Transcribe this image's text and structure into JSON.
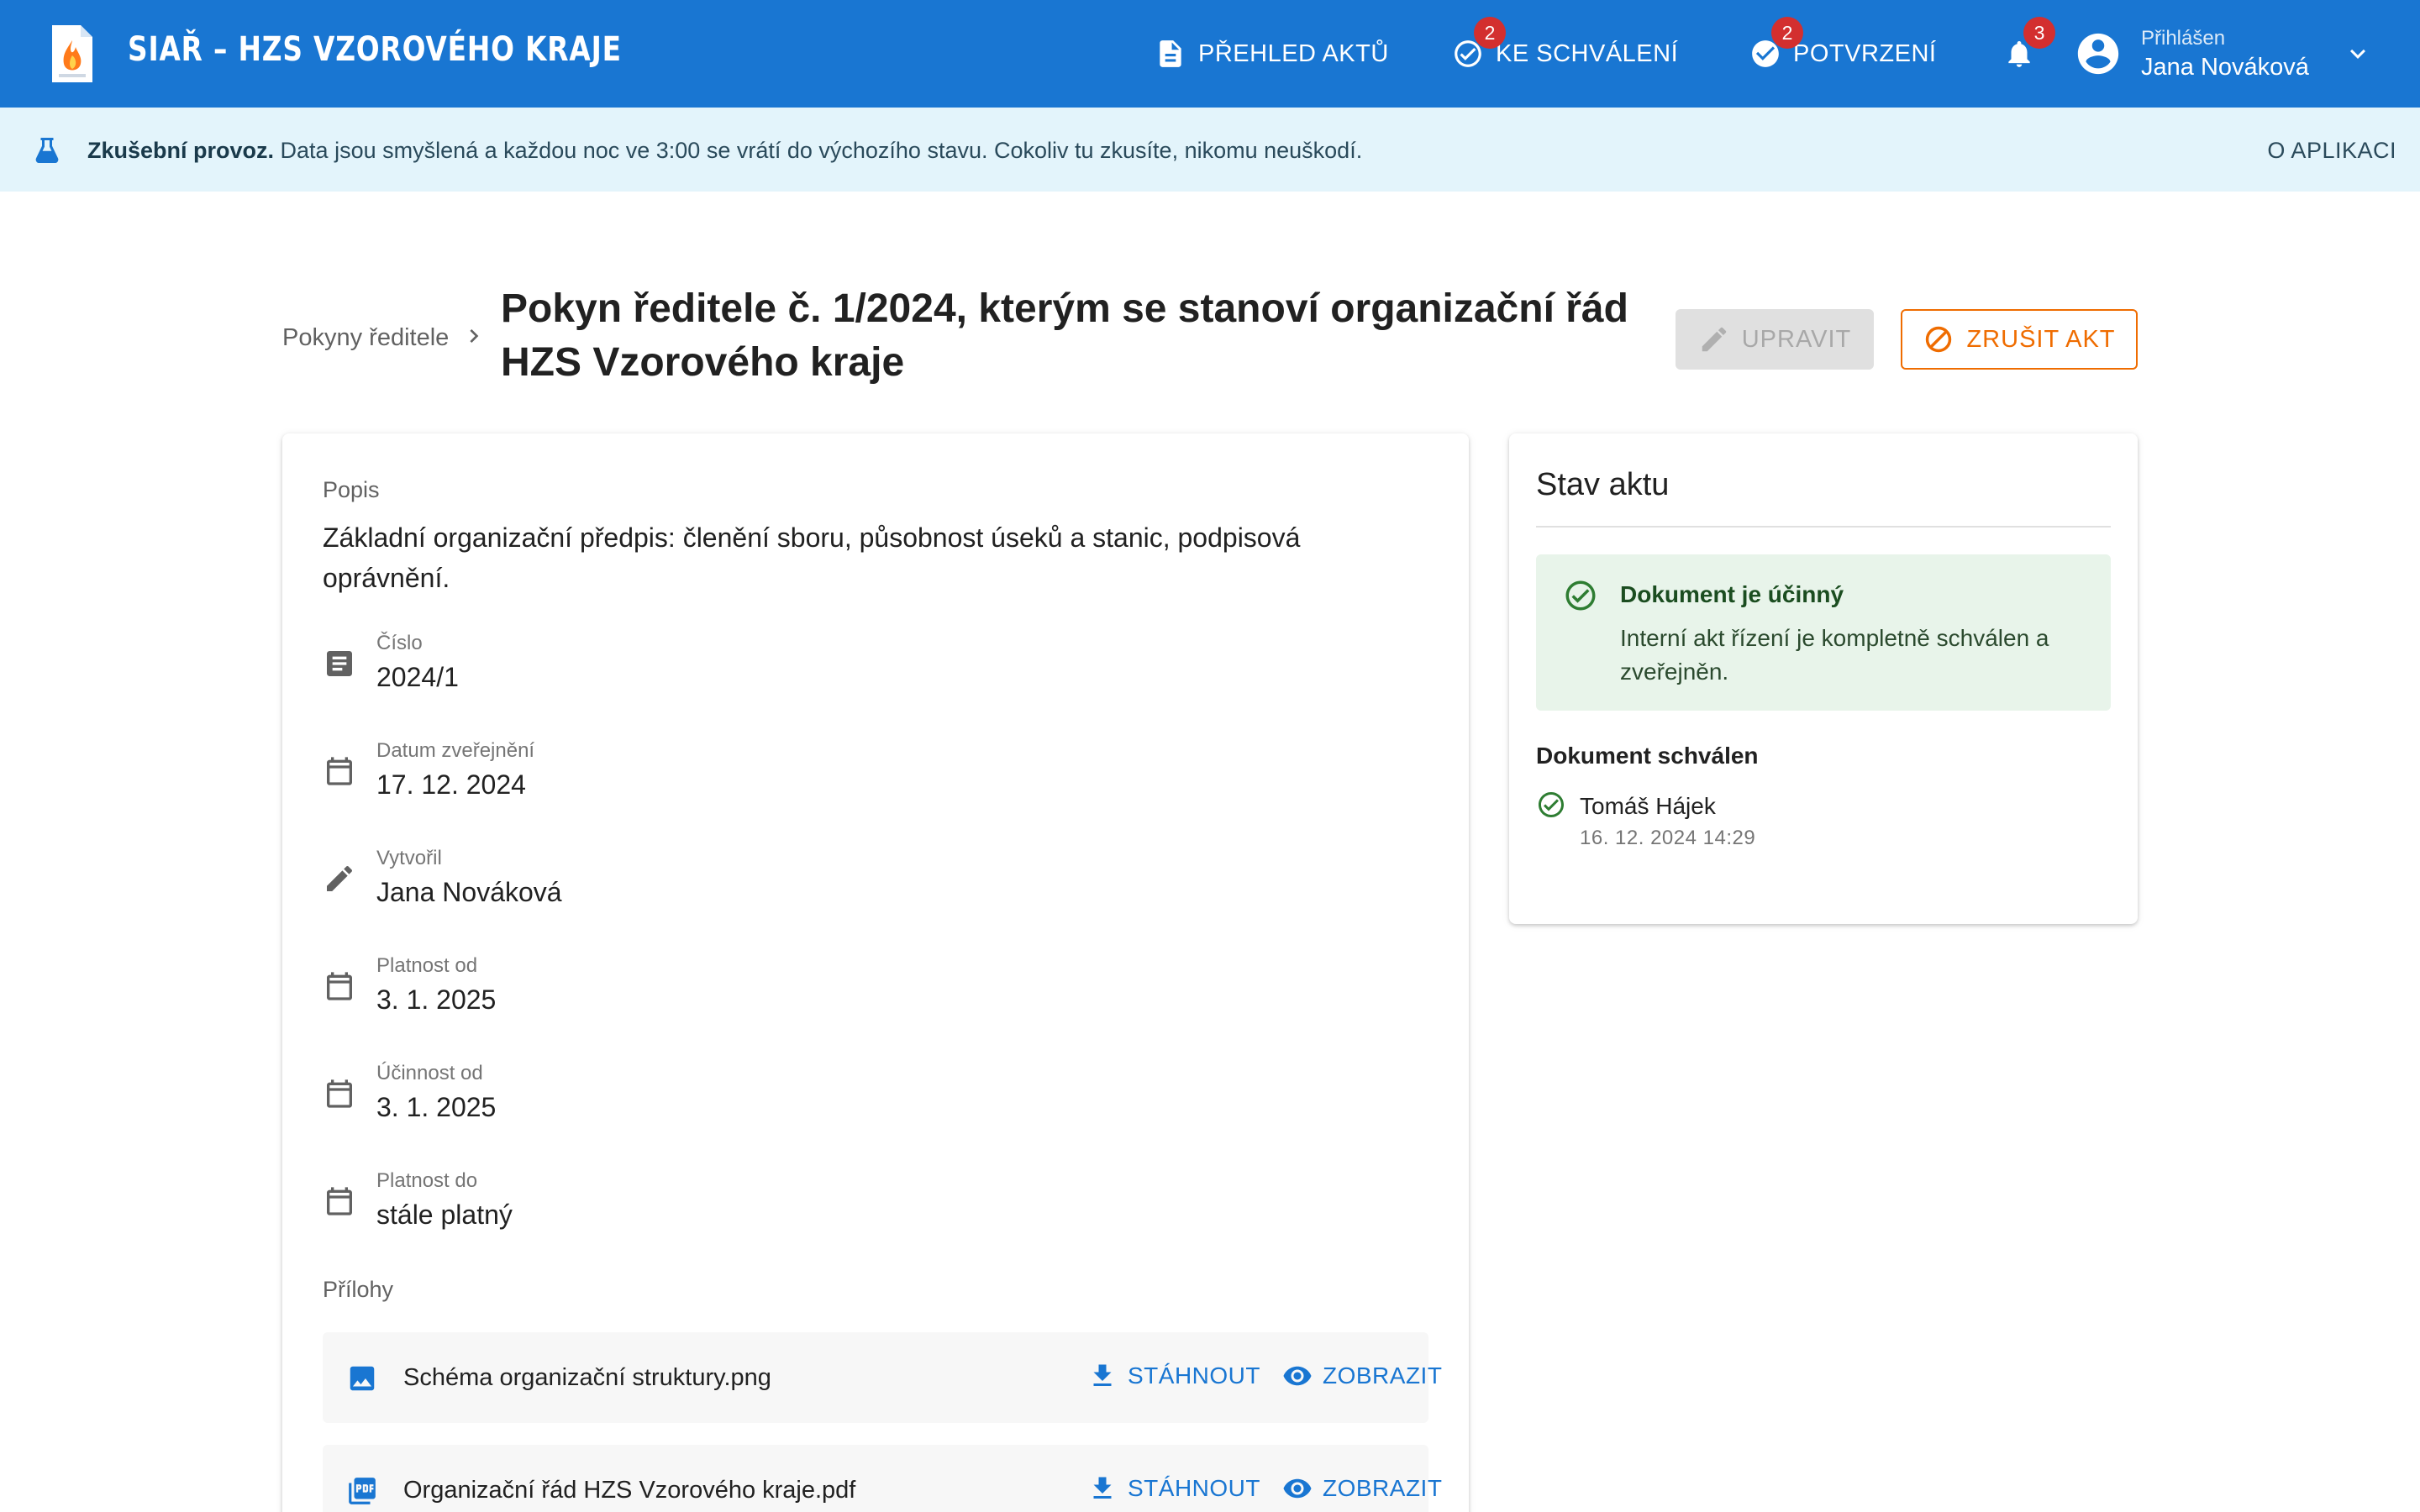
{
  "header": {
    "app_title": "SIAŘ – HZS VZOROVÉHO KRAJE",
    "nav": {
      "overview": {
        "label": "PŘEHLED AKTŮ",
        "icon": "document-icon"
      },
      "approval": {
        "label": "KE SCHVÁLENÍ",
        "icon": "check-circle-outline-icon",
        "badge": "2"
      },
      "confirm": {
        "label": "POTVRZENÍ",
        "icon": "check-circle-icon",
        "badge": "2"
      },
      "notifications": {
        "icon": "bell-icon",
        "badge": "3"
      }
    },
    "user": {
      "label": "Přihlášen",
      "name": "Jana Nováková"
    },
    "brand_color": "#1976d2"
  },
  "banner": {
    "bold": "Zkušební provoz.",
    "text": " Data jsou smyšlená a každou noc ve 3:00 se vrátí do výchozího stavu. Cokoliv tu zkusíte, nikomu neuškodí.",
    "link": "O APLIKACI",
    "background": "#e3f4fb"
  },
  "page": {
    "breadcrumb": "Pokyny ředitele",
    "title": "Pokyn ředitele č. 1/2024, kterým se stanoví organizační řád HZS Vzorového kraje",
    "actions": {
      "edit": "UPRAVIT",
      "cancel": "ZRUŠIT AKT"
    }
  },
  "details": {
    "description_label": "Popis",
    "description": "Základní organizační předpis: členění sboru, působnost úseků a stanic, podpisová oprávnění.",
    "fields": [
      {
        "label": "Číslo",
        "value": "2024/1",
        "icon": "notes-icon"
      },
      {
        "label": "Datum zveřejnění",
        "value": "17. 12. 2024",
        "icon": "calendar-icon"
      },
      {
        "label": "Vytvořil",
        "value": "Jana Nováková",
        "icon": "pencil-icon"
      },
      {
        "label": "Platnost od",
        "value": "3. 1. 2025",
        "icon": "calendar-icon"
      },
      {
        "label": "Účinnost od",
        "value": "3. 1. 2025",
        "icon": "calendar-icon"
      },
      {
        "label": "Platnost do",
        "value": "stále platný",
        "icon": "calendar-icon"
      }
    ],
    "attachments_label": "Přílohy",
    "attachments": [
      {
        "name": "Schéma organizační struktury.png",
        "icon": "image-icon",
        "download": "STÁHNOUT",
        "view": "ZOBRAZIT"
      },
      {
        "name": "Organizační řád HZS Vzorového kraje.pdf",
        "icon": "pdf-icon",
        "download": "STÁHNOUT",
        "view": "ZOBRAZIT"
      }
    ]
  },
  "status": {
    "title": "Stav aktu",
    "box_title": "Dokument je účinný",
    "box_text": "Interní akt řízení je kompletně schválen a zveřejněn.",
    "approved_title": "Dokument schválen",
    "approver": {
      "name": "Tomáš Hájek",
      "time": "16. 12. 2024 14:29"
    },
    "success_color": "#2e7d32"
  }
}
